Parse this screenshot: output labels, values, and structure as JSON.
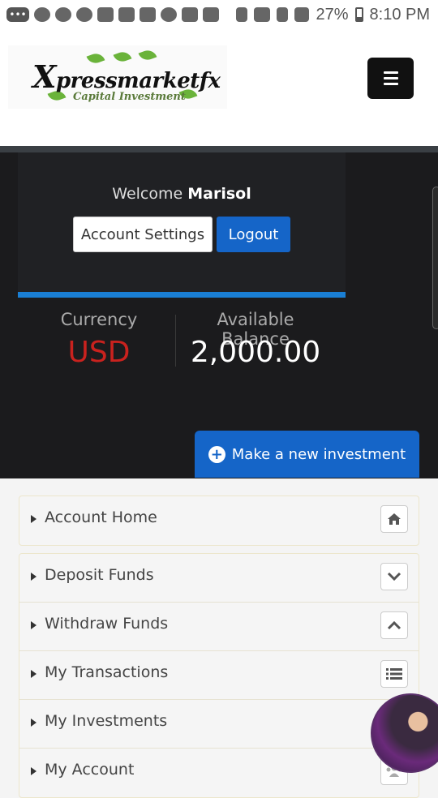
{
  "status_bar": {
    "battery": "27%",
    "time": "8:10 PM"
  },
  "logo": {
    "title_first": "X",
    "title_rest": "pressmarketfx",
    "subtitle": "Capital Investment"
  },
  "account": {
    "welcome_text": "Welcome",
    "user_name": "Marisol",
    "settings_label": "Account Settings",
    "logout_label": "Logout"
  },
  "balance": {
    "currency_label": "Currency",
    "currency_value": "USD",
    "balance_label": "Available Balance",
    "balance_value": "2,000.00"
  },
  "invest_button": {
    "label": "Make a new investment"
  },
  "menu": {
    "home": {
      "label": "Account Home",
      "icon": "home-icon"
    },
    "items": [
      {
        "label": "Deposit Funds",
        "icon": "chevron-down-icon"
      },
      {
        "label": "Withdraw Funds",
        "icon": "chevron-up-icon"
      },
      {
        "label": "My Transactions",
        "icon": "list-icon"
      },
      {
        "label": "My Investments",
        "icon": "chart-icon"
      },
      {
        "label": "My Account",
        "icon": "users-icon"
      }
    ]
  },
  "colors": {
    "accent_blue": "#1565c8",
    "currency_red": "#c9221e",
    "dark_panel": "#1b1b1d"
  }
}
